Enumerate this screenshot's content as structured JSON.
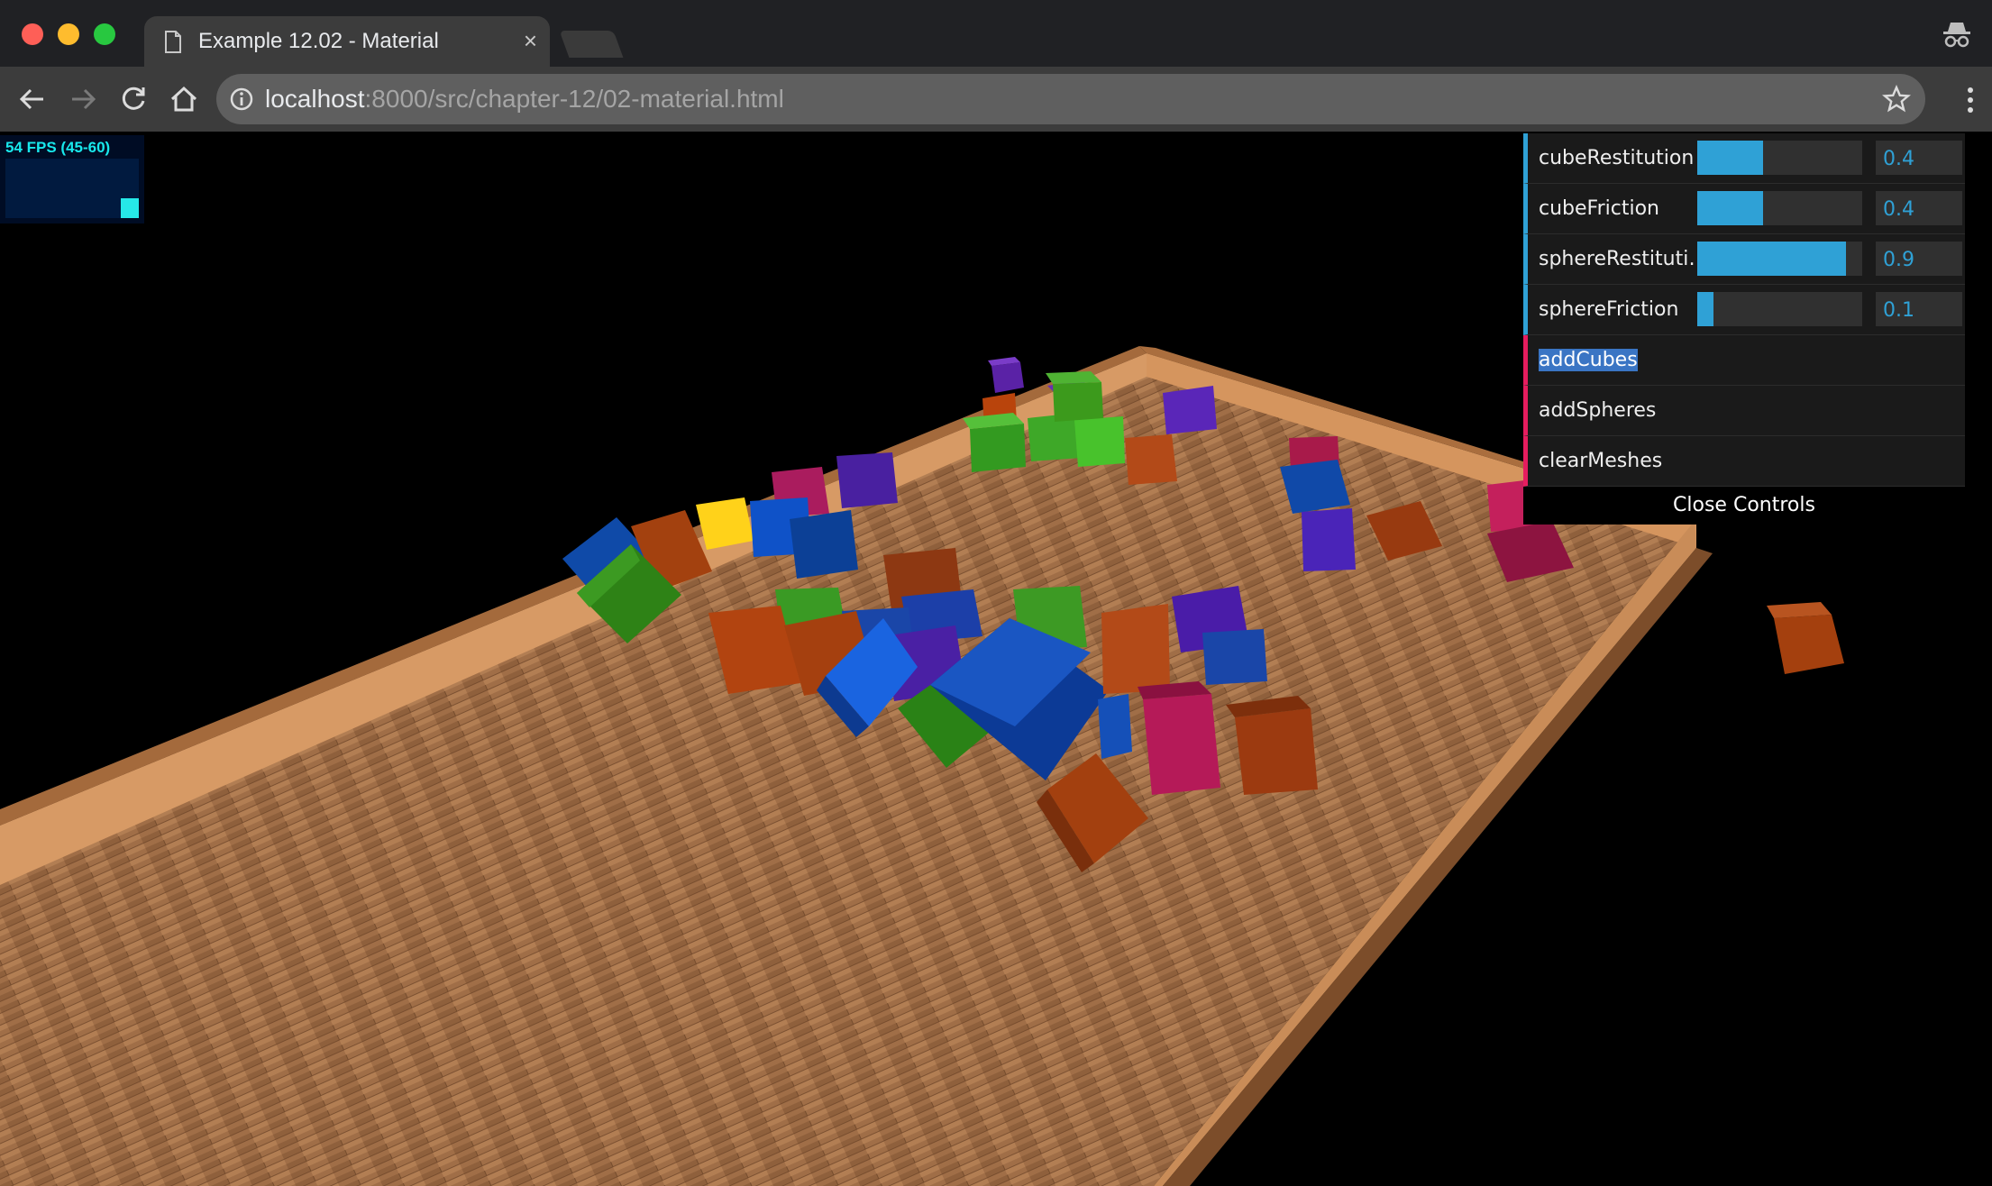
{
  "browser": {
    "tab_title": "Example 12.02 - Material",
    "tab_close": "×",
    "url_host": "localhost",
    "url_rest": ":8000/src/chapter-12/02-material.html"
  },
  "stats": {
    "fps_text": "54 FPS (45-60)",
    "level": 0.33
  },
  "gui": {
    "controls": [
      {
        "label": "cubeRestitution",
        "value": "0.4",
        "fill": 0.4
      },
      {
        "label": "cubeFriction",
        "value": "0.4",
        "fill": 0.4
      },
      {
        "label": "sphereRestituti…",
        "value": "0.9",
        "fill": 0.9
      },
      {
        "label": "sphereFriction",
        "value": "0.1",
        "fill": 0.1
      }
    ],
    "buttons": [
      "addCubes",
      "addSpheres",
      "clearMeshes"
    ],
    "close_label": "Close Controls"
  },
  "colors": {
    "accent_number": "#2fa1d6",
    "accent_function": "#e61d5f"
  }
}
